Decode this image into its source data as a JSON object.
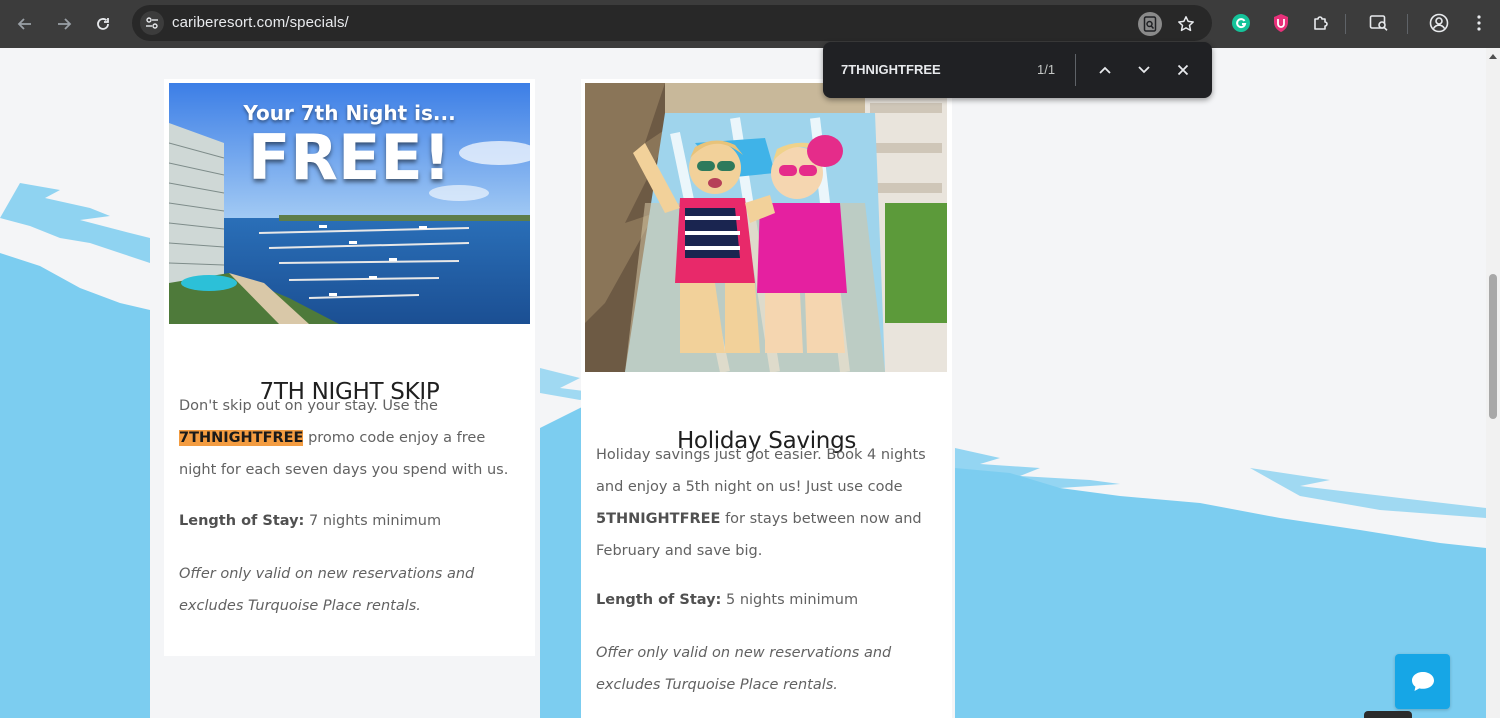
{
  "browser": {
    "url": "cariberesort.com/specials/",
    "colors": {
      "toolbar": "#3c3c3c",
      "omnibox": "#282828"
    }
  },
  "find_bar": {
    "query": "7THNIGHTFREE",
    "count": "1/1"
  },
  "cards": [
    {
      "title": "7TH NIGHT SKIP",
      "image_title_line1": "Your 7th Night is...",
      "image_title_line2": "FREE!",
      "desc_pre": "Don't skip out on your stay. Use the ",
      "promo_code": "7THNIGHTFREE",
      "desc_post": " promo code enjoy a free night for each seven days you spend with us.",
      "stay_label": "Length of Stay:",
      "stay_value": " 7 nights minimum",
      "disclaimer": "Offer only valid on new reservations and excludes Turquoise Place rentals."
    },
    {
      "title": "Holiday Savings",
      "desc_pre": "Holiday savings just got easier. Book 4 nights and enjoy a 5th night on us! Just use code ",
      "promo_code": "5THNIGHTFREE",
      "desc_post": " for stays between now and February and save big.",
      "stay_label": "Length of Stay:",
      "stay_value": " 5 nights minimum",
      "disclaimer": "Offer only valid on new reservations and excludes Turquoise Place rentals."
    }
  ],
  "colors": {
    "highlight": "#f39c41",
    "wave_blue": "#7ccdf0",
    "chat_button": "#16a6e6"
  }
}
